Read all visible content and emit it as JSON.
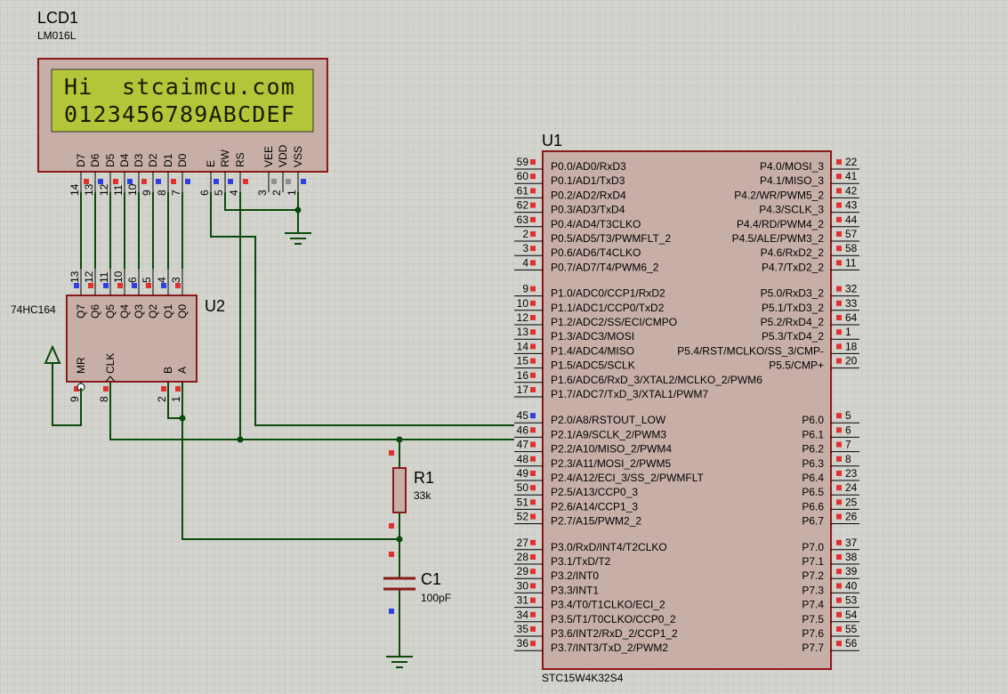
{
  "lcd": {
    "ref": "LCD1",
    "part": "LM016L",
    "line1": "Hi  stcaimcu.com",
    "line2": "0123456789ABCDEF",
    "pins": [
      {
        "name": "D7",
        "num": "14"
      },
      {
        "name": "D6",
        "num": "13"
      },
      {
        "name": "D5",
        "num": "12"
      },
      {
        "name": "D4",
        "num": "11"
      },
      {
        "name": "D3",
        "num": "10"
      },
      {
        "name": "D2",
        "num": "9"
      },
      {
        "name": "D1",
        "num": "8"
      },
      {
        "name": "D0",
        "num": "7"
      },
      {
        "name": "E",
        "num": "6"
      },
      {
        "name": "RW",
        "num": "5"
      },
      {
        "name": "RS",
        "num": "4"
      },
      {
        "name": "VEE",
        "num": "3"
      },
      {
        "name": "VDD",
        "num": "2"
      },
      {
        "name": "VSS",
        "num": "1"
      }
    ]
  },
  "shift": {
    "ref": "U2",
    "part": "74HC164",
    "top_pins": [
      {
        "name": "Q7",
        "num": "13"
      },
      {
        "name": "Q6",
        "num": "12"
      },
      {
        "name": "Q5",
        "num": "11"
      },
      {
        "name": "Q4",
        "num": "10"
      },
      {
        "name": "Q3",
        "num": "6"
      },
      {
        "name": "Q2",
        "num": "5"
      },
      {
        "name": "Q1",
        "num": "4"
      },
      {
        "name": "Q0",
        "num": "3"
      }
    ],
    "bottom_pins": [
      {
        "name": "MR",
        "num": "9"
      },
      {
        "name": "CLK",
        "num": "8"
      },
      {
        "name": "B",
        "num": "2"
      },
      {
        "name": "A",
        "num": "1"
      }
    ]
  },
  "resistor": {
    "ref": "R1",
    "value": "33k"
  },
  "capacitor": {
    "ref": "C1",
    "value": "100pF"
  },
  "mcu": {
    "ref": "U1",
    "part": "STC15W4K32S4",
    "left_pins": [
      {
        "name": "P0.0/AD0/RxD3",
        "num": "59"
      },
      {
        "name": "P0.1/AD1/TxD3",
        "num": "60"
      },
      {
        "name": "P0.2/AD2/RxD4",
        "num": "61"
      },
      {
        "name": "P0.3/AD3/TxD4",
        "num": "62"
      },
      {
        "name": "P0.4/AD4/T3CLKO",
        "num": "63"
      },
      {
        "name": "P0.5/AD5/T3/PWMFLT_2",
        "num": "2"
      },
      {
        "name": "P0.6/AD6/T4CLKO",
        "num": "3"
      },
      {
        "name": "P0.7/AD7/T4/PWM6_2",
        "num": "4"
      },
      {
        "name": "P1.0/ADC0/CCP1/RxD2",
        "num": "9"
      },
      {
        "name": "P1.1/ADC1/CCP0/TxD2",
        "num": "10"
      },
      {
        "name": "P1.2/ADC2/SS/ECI/CMPO",
        "num": "12"
      },
      {
        "name": "P1.3/ADC3/MOSI",
        "num": "13"
      },
      {
        "name": "P1.4/ADC4/MISO",
        "num": "14"
      },
      {
        "name": "P1.5/ADC5/SCLK",
        "num": "15"
      },
      {
        "name": "P1.6/ADC6/RxD_3/XTAL2/MCLKO_2/PWM6",
        "num": "16"
      },
      {
        "name": "P1.7/ADC7/TxD_3/XTAL1/PWM7",
        "num": "17"
      },
      {
        "name": "P2.0/A8/RSTOUT_LOW",
        "num": "45"
      },
      {
        "name": "P2.1/A9/SCLK_2/PWM3",
        "num": "46"
      },
      {
        "name": "P2.2/A10/MISO_2/PWM4",
        "num": "47"
      },
      {
        "name": "P2.3/A11/MOSI_2/PWM5",
        "num": "48"
      },
      {
        "name": "P2.4/A12/ECI_3/SS_2/PWMFLT",
        "num": "49"
      },
      {
        "name": "P2.5/A13/CCP0_3",
        "num": "50"
      },
      {
        "name": "P2.6/A14/CCP1_3",
        "num": "51"
      },
      {
        "name": "P2.7/A15/PWM2_2",
        "num": "52"
      },
      {
        "name": "P3.0/RxD/INT4/T2CLKO",
        "num": "27"
      },
      {
        "name": "P3.1/TxD/T2",
        "num": "28"
      },
      {
        "name": "P3.2/INT0",
        "num": "29"
      },
      {
        "name": "P3.3/INT1",
        "num": "30"
      },
      {
        "name": "P3.4/T0/T1CLKO/ECI_2",
        "num": "31"
      },
      {
        "name": "P3.5/T1/T0CLKO/CCP0_2",
        "num": "34"
      },
      {
        "name": "P3.6/INT2/RxD_2/CCP1_2",
        "num": "35"
      },
      {
        "name": "P3.7/INT3/TxD_2/PWM2",
        "num": "36"
      }
    ],
    "right_pins": [
      {
        "name": "P4.0/MOSI_3",
        "num": "22"
      },
      {
        "name": "P4.1/MISO_3",
        "num": "41"
      },
      {
        "name": "P4.2/WR/PWM5_2",
        "num": "42"
      },
      {
        "name": "P4.3/SCLK_3",
        "num": "43"
      },
      {
        "name": "P4.4/RD/PWM4_2",
        "num": "44"
      },
      {
        "name": "P4.5/ALE/PWM3_2",
        "num": "57"
      },
      {
        "name": "P4.6/RxD2_2",
        "num": "58"
      },
      {
        "name": "P4.7/TxD2_2",
        "num": "11"
      },
      {
        "name": "P5.0/RxD3_2",
        "num": "32"
      },
      {
        "name": "P5.1/TxD3_2",
        "num": "33"
      },
      {
        "name": "P5.2/RxD4_2",
        "num": "64"
      },
      {
        "name": "P5.3/TxD4_2",
        "num": "1"
      },
      {
        "name": "P5.4/RST/MCLKO/SS_3/CMP-",
        "num": "18"
      },
      {
        "name": "P5.5/CMP+",
        "num": "20"
      },
      {
        "name": "P6.0",
        "num": "5"
      },
      {
        "name": "P6.1",
        "num": "6"
      },
      {
        "name": "P6.2",
        "num": "7"
      },
      {
        "name": "P6.3",
        "num": "8"
      },
      {
        "name": "P6.4",
        "num": "23"
      },
      {
        "name": "P6.5",
        "num": "24"
      },
      {
        "name": "P6.6",
        "num": "25"
      },
      {
        "name": "P6.7",
        "num": "26"
      },
      {
        "name": "P7.0",
        "num": "37"
      },
      {
        "name": "P7.1",
        "num": "38"
      },
      {
        "name": "P7.2",
        "num": "39"
      },
      {
        "name": "P7.3",
        "num": "40"
      },
      {
        "name": "P7.4",
        "num": "53"
      },
      {
        "name": "P7.5",
        "num": "54"
      },
      {
        "name": "P7.6",
        "num": "55"
      },
      {
        "name": "P7.7",
        "num": "56"
      }
    ]
  },
  "colors": {
    "background": "#d4d4cf",
    "grid": "#c3c3bd",
    "component_fill": "#c7afa8",
    "component_border": "#8b1a1a",
    "wire": "#0a4a0a",
    "lcd_screen": "#b5c53a",
    "pin_red": "#e03030",
    "pin_blue": "#3040e0",
    "pin_gray": "#909090"
  }
}
